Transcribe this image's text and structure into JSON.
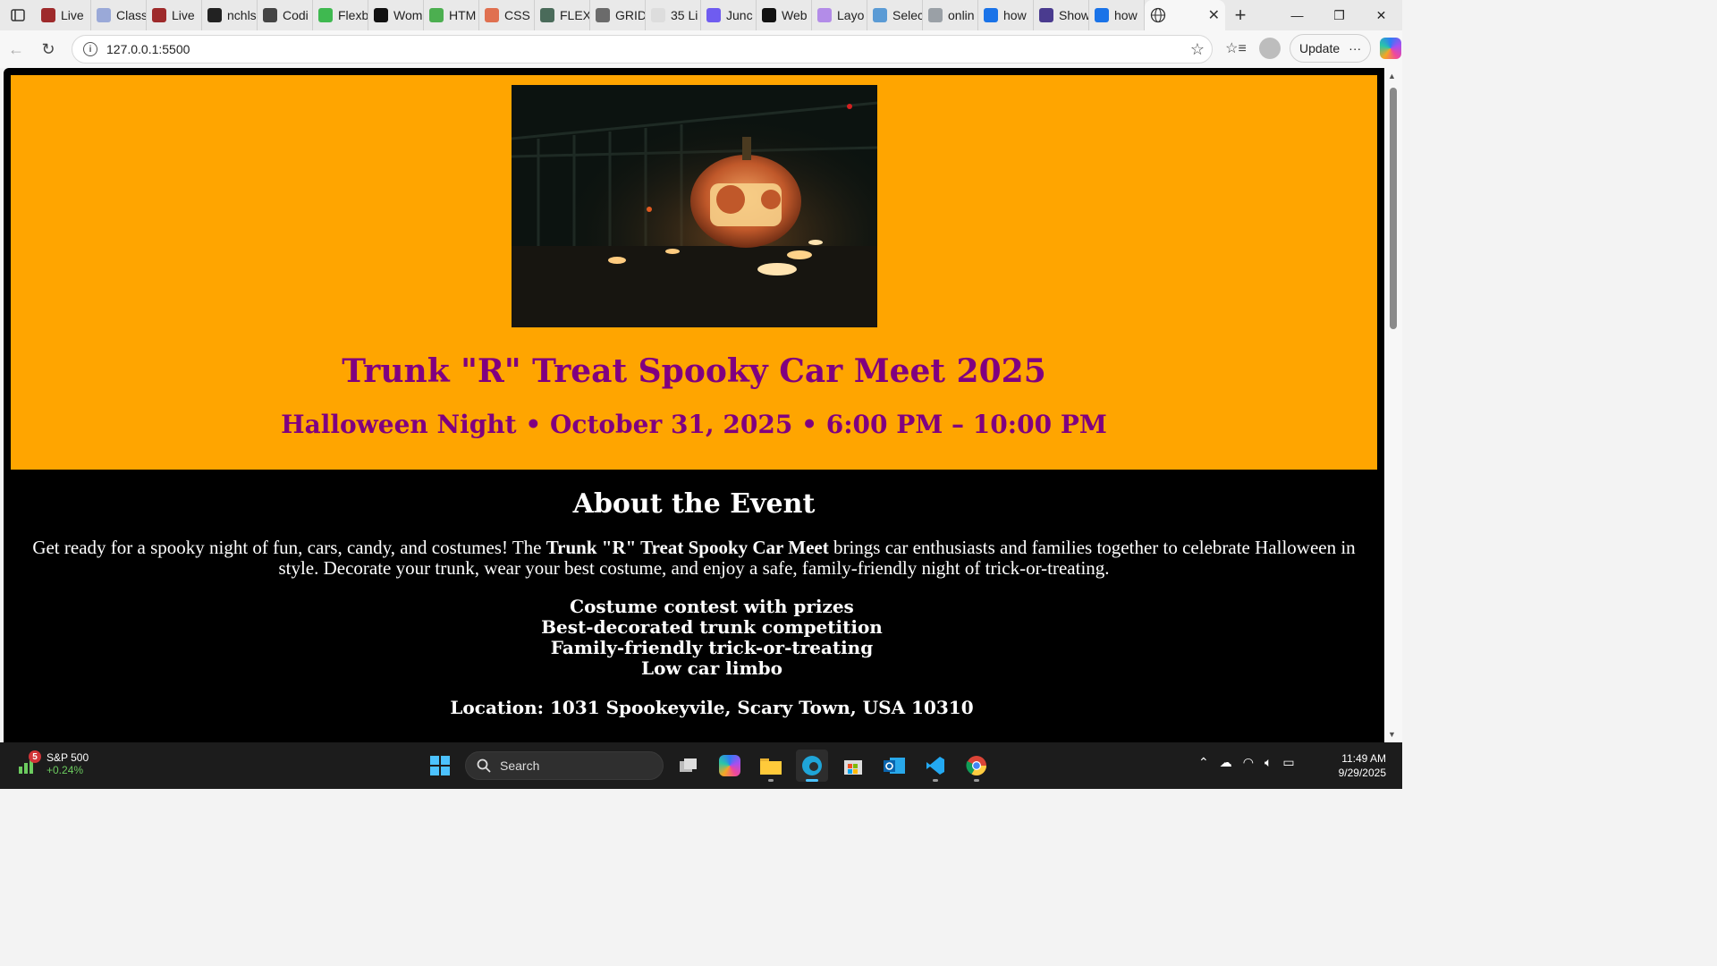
{
  "browser": {
    "tabs": [
      {
        "label": "Live",
        "color": "#9e2a2b"
      },
      {
        "label": "Class",
        "color": "#9aa9d8"
      },
      {
        "label": "Live",
        "color": "#9e2a2b"
      },
      {
        "label": "nchls",
        "color": "#222222"
      },
      {
        "label": "Codi",
        "color": "#444444"
      },
      {
        "label": "Flexb",
        "color": "#3fb950"
      },
      {
        "label": "Wom",
        "color": "#111111"
      },
      {
        "label": "HTM",
        "color": "#4caf50"
      },
      {
        "label": "CSS",
        "color": "#e07050"
      },
      {
        "label": "FLEX",
        "color": "#4a6b5a"
      },
      {
        "label": "GRID",
        "color": "#6b6b6b"
      },
      {
        "label": "35 Li",
        "color": "#dddddd"
      },
      {
        "label": "Junc",
        "color": "#6f5cf0"
      },
      {
        "label": "Web",
        "color": "#111111"
      },
      {
        "label": "Layo",
        "color": "#b38ce8"
      },
      {
        "label": "Selec",
        "color": "#5b9bd5"
      },
      {
        "label": "onlin",
        "color": "#9aa0a6"
      },
      {
        "label": "how",
        "color": "#1a73e8"
      },
      {
        "label": "Show",
        "color": "#4a3b8f"
      },
      {
        "label": "how",
        "color": "#1a73e8"
      }
    ],
    "active_tab_icon": "globe-icon",
    "url": "127.0.0.1:5500",
    "update_label": "Update",
    "more_label": "···"
  },
  "page": {
    "title": "Trunk \"R\" Treat Spooky Car Meet 2025",
    "subtitle": "Halloween Night • October 31, 2025 • 6:00 PM – 10:00 PM",
    "about_heading": "About the Event",
    "about_pre": "Get ready for a spooky night of fun, cars, candy, and costumes! The ",
    "about_bold": "Trunk \"R\" Treat Spooky Car Meet",
    "about_post": " brings car enthusiasts and families together to celebrate Halloween in style. Decorate your trunk, wear your best costume, and enjoy a safe, family-friendly night of trick-or-treating.",
    "features": [
      "Costume contest with prizes",
      "Best-decorated trunk competition",
      "Family-friendly trick-or-treating",
      "Low car limbo"
    ],
    "location": "Location: 1031 Spookeyvile, Scary Town, USA 10310",
    "colors": {
      "hero_bg": "#ffa500",
      "heading": "#800080",
      "body_bg": "#000000",
      "body_text": "#ffffff"
    }
  },
  "taskbar": {
    "widget_name": "S&P 500",
    "widget_change": "+0.24%",
    "widget_badge": "5",
    "search_placeholder": "Search",
    "time": "11:49 AM",
    "date": "9/29/2025"
  }
}
